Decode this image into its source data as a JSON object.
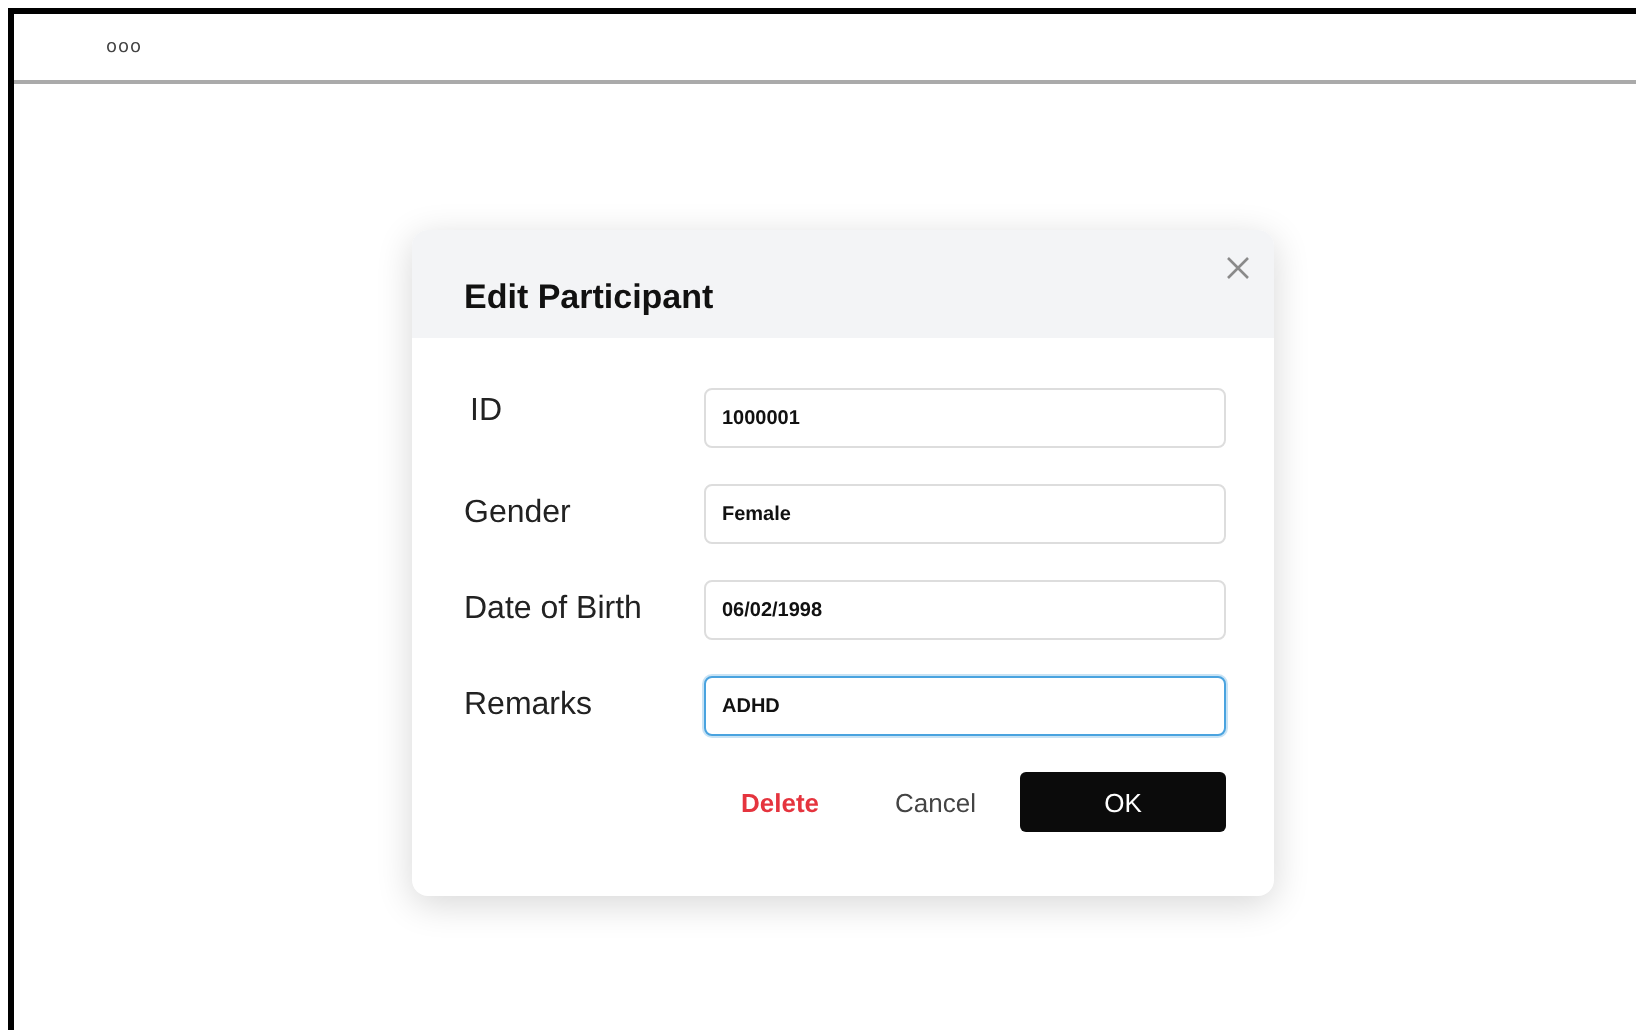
{
  "top_bar": {
    "text": "ooo"
  },
  "dialog": {
    "title": "Edit Participant",
    "fields": [
      {
        "label": "ID",
        "value": "1000001",
        "focused": false
      },
      {
        "label": "Gender",
        "value": "Female",
        "focused": false
      },
      {
        "label": "Date of Birth",
        "value": "06/02/1998",
        "focused": false
      },
      {
        "label": "Remarks",
        "value": "ADHD",
        "focused": true
      }
    ],
    "buttons": [
      {
        "label": "Delete",
        "kind": "danger"
      },
      {
        "label": "Cancel",
        "kind": "plain"
      },
      {
        "label": "OK",
        "kind": "primary"
      }
    ]
  }
}
